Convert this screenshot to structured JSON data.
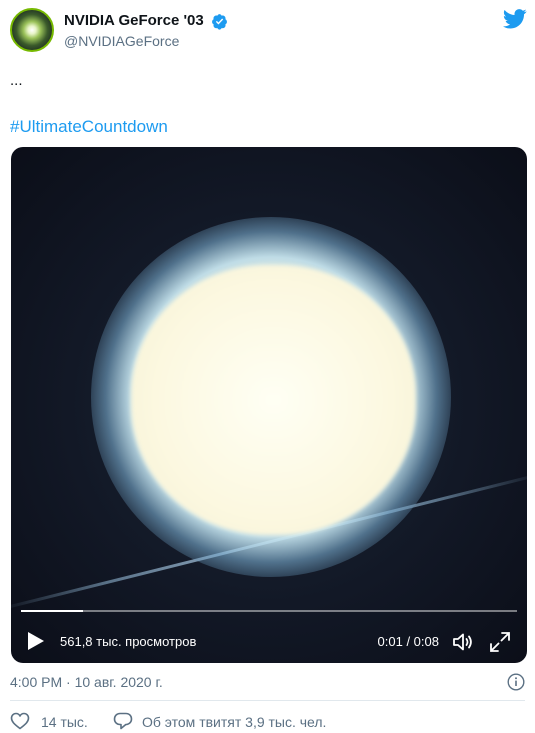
{
  "author": {
    "display_name": "NVIDIA GeForce '03",
    "handle": "@NVIDIAGeForce"
  },
  "tweet": {
    "text": "...",
    "hashtag": "#UltimateCountdown"
  },
  "video": {
    "views": "561,8 тыс. просмотров",
    "time": "0:01 / 0:08",
    "progress": 0.125
  },
  "meta": {
    "timestamp": "4:00 PM · 10 авг. 2020 г."
  },
  "actions": {
    "likes": "14 тыс.",
    "discussion": "Об этом твитят 3,9 тыс. чел."
  },
  "colors": {
    "accent": "#1d9bf0",
    "secondary_text": "#5b7083",
    "divider": "#e1e8ed",
    "verified": "#1d9bf0"
  }
}
